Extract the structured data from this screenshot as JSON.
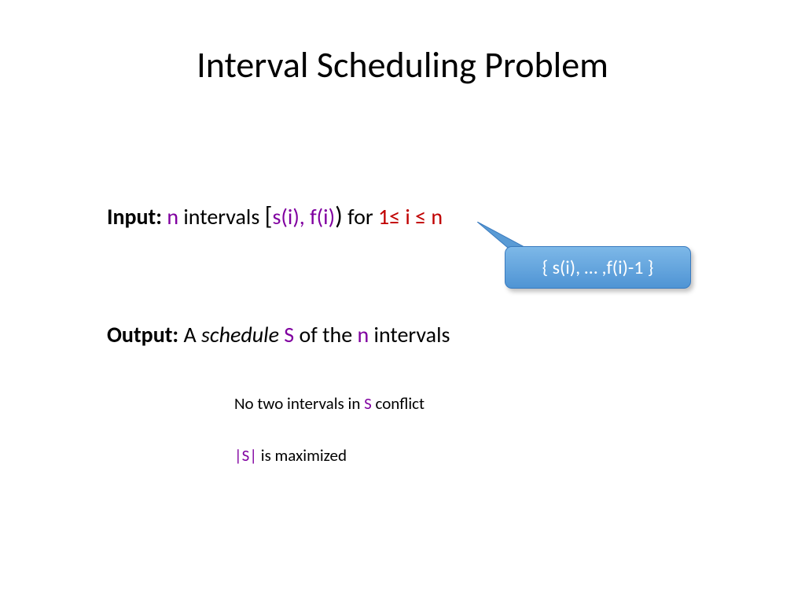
{
  "title": "Interval Scheduling Problem",
  "input": {
    "label": "Input:",
    "n": "n",
    "text1": " intervals  ",
    "bracket_open": "[",
    "interval_notation": "s(i), f(i)",
    "bracket_close": ")",
    "text2": " for ",
    "range": "1≤ i ≤ n"
  },
  "callout": {
    "text": "{ s(i), … ,f(i)-1 }"
  },
  "output": {
    "label": "Output:",
    "text1": " A ",
    "schedule_word": "schedule",
    "S": " S",
    "text2": " of the ",
    "n": "n",
    "text3": " intervals"
  },
  "constraint1": {
    "pre": "No two intervals in ",
    "S": "S",
    "post": " conflict"
  },
  "constraint2": {
    "S": "|S|",
    "post": " is maximized"
  }
}
